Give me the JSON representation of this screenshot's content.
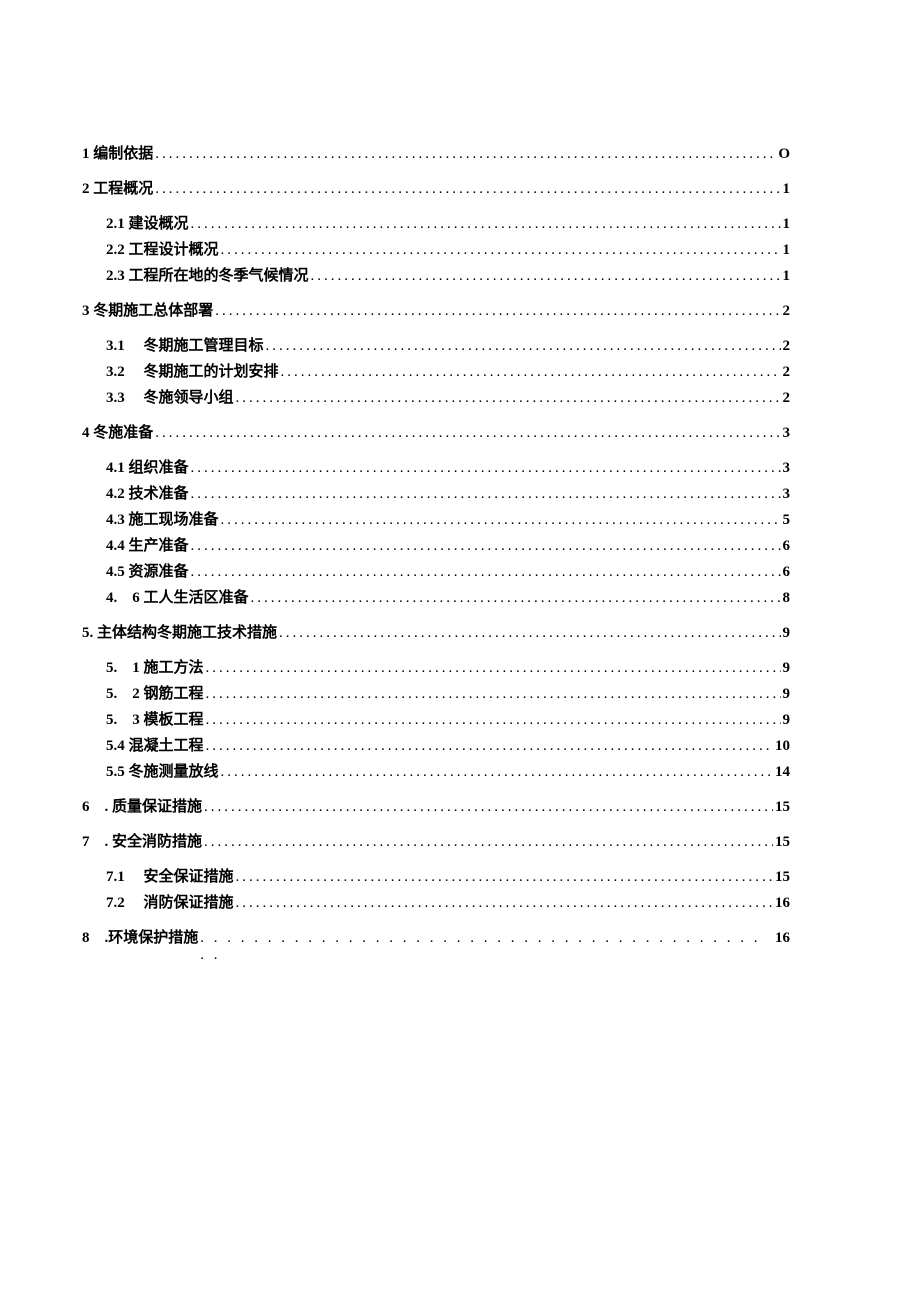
{
  "toc": [
    {
      "level": 0,
      "num": "1",
      "title": "编制依据",
      "page": "O"
    },
    {
      "level": 0,
      "num": "2",
      "title": "工程概况",
      "page": "1"
    },
    {
      "level": 1,
      "num": "2.1",
      "title": "建设概况",
      "page": "1"
    },
    {
      "level": 1,
      "num": "2.2",
      "title": "工程设计概况",
      "page": "1"
    },
    {
      "level": 1,
      "num": "2.3",
      "title": "工程所在地的冬季气候情况",
      "page": "1"
    },
    {
      "level": 0,
      "num": "3",
      "title": "冬期施工总体部署",
      "page": "2"
    },
    {
      "level": 1,
      "num": "3.1",
      "spaced": true,
      "title": "冬期施工管理目标",
      "page": "2"
    },
    {
      "level": 1,
      "num": "3.2",
      "spaced": true,
      "title": "冬期施工的计划安排",
      "page": "2"
    },
    {
      "level": 1,
      "num": "3.3",
      "spaced": true,
      "title": "冬施领导小组",
      "page": "2"
    },
    {
      "level": 0,
      "num": "4",
      "title": "冬施准备",
      "page": "3"
    },
    {
      "level": 1,
      "num": "4.1",
      "title": "组织准备",
      "page": "3"
    },
    {
      "level": 1,
      "num": "4.2",
      "title": "技术准备",
      "page": "3"
    },
    {
      "level": 1,
      "num": "4.3",
      "title": "施工现场准备",
      "page": "5"
    },
    {
      "level": 1,
      "num": "4.4",
      "title": "生产准备",
      "page": "6"
    },
    {
      "level": 1,
      "num": "4.5",
      "title": "资源准备",
      "page": "6"
    },
    {
      "level": 1,
      "num": "4.　6",
      "title": "工人生活区准备",
      "page": "8"
    },
    {
      "level": 0,
      "num": "5.",
      "title": "主体结构冬期施工技术措施",
      "page": "9"
    },
    {
      "level": 1,
      "num": "5.　1",
      "title": "施工方法",
      "page": "9"
    },
    {
      "level": 1,
      "num": "5.　2",
      "title": "钢筋工程",
      "page": "9"
    },
    {
      "level": 1,
      "num": "5.　3",
      "title": "模板工程",
      "page": "9"
    },
    {
      "level": 1,
      "num": "5.4",
      "title": "混凝土工程",
      "page": "10"
    },
    {
      "level": 1,
      "num": "5.5",
      "title": "冬施测量放线",
      "page": "14"
    },
    {
      "level": 0,
      "num": "6　.",
      "title": "质量保证措施",
      "page": "15"
    },
    {
      "level": 0,
      "num": "7　.",
      "title": "安全消防措施",
      "page": "15"
    },
    {
      "level": 1,
      "num": "7.1",
      "spaced": true,
      "title": "安全保证措施",
      "page": "15"
    },
    {
      "level": 1,
      "num": "7.2",
      "spaced": true,
      "title": "消防保证措施",
      "page": "16"
    }
  ],
  "section8": {
    "num": "8　.",
    "title": "环境保护措施",
    "dots": ". . . . . . . . . . . . . . . . . . . . . . . . . . . . . . . . . . . . . . . . . . . .",
    "page": "16"
  }
}
